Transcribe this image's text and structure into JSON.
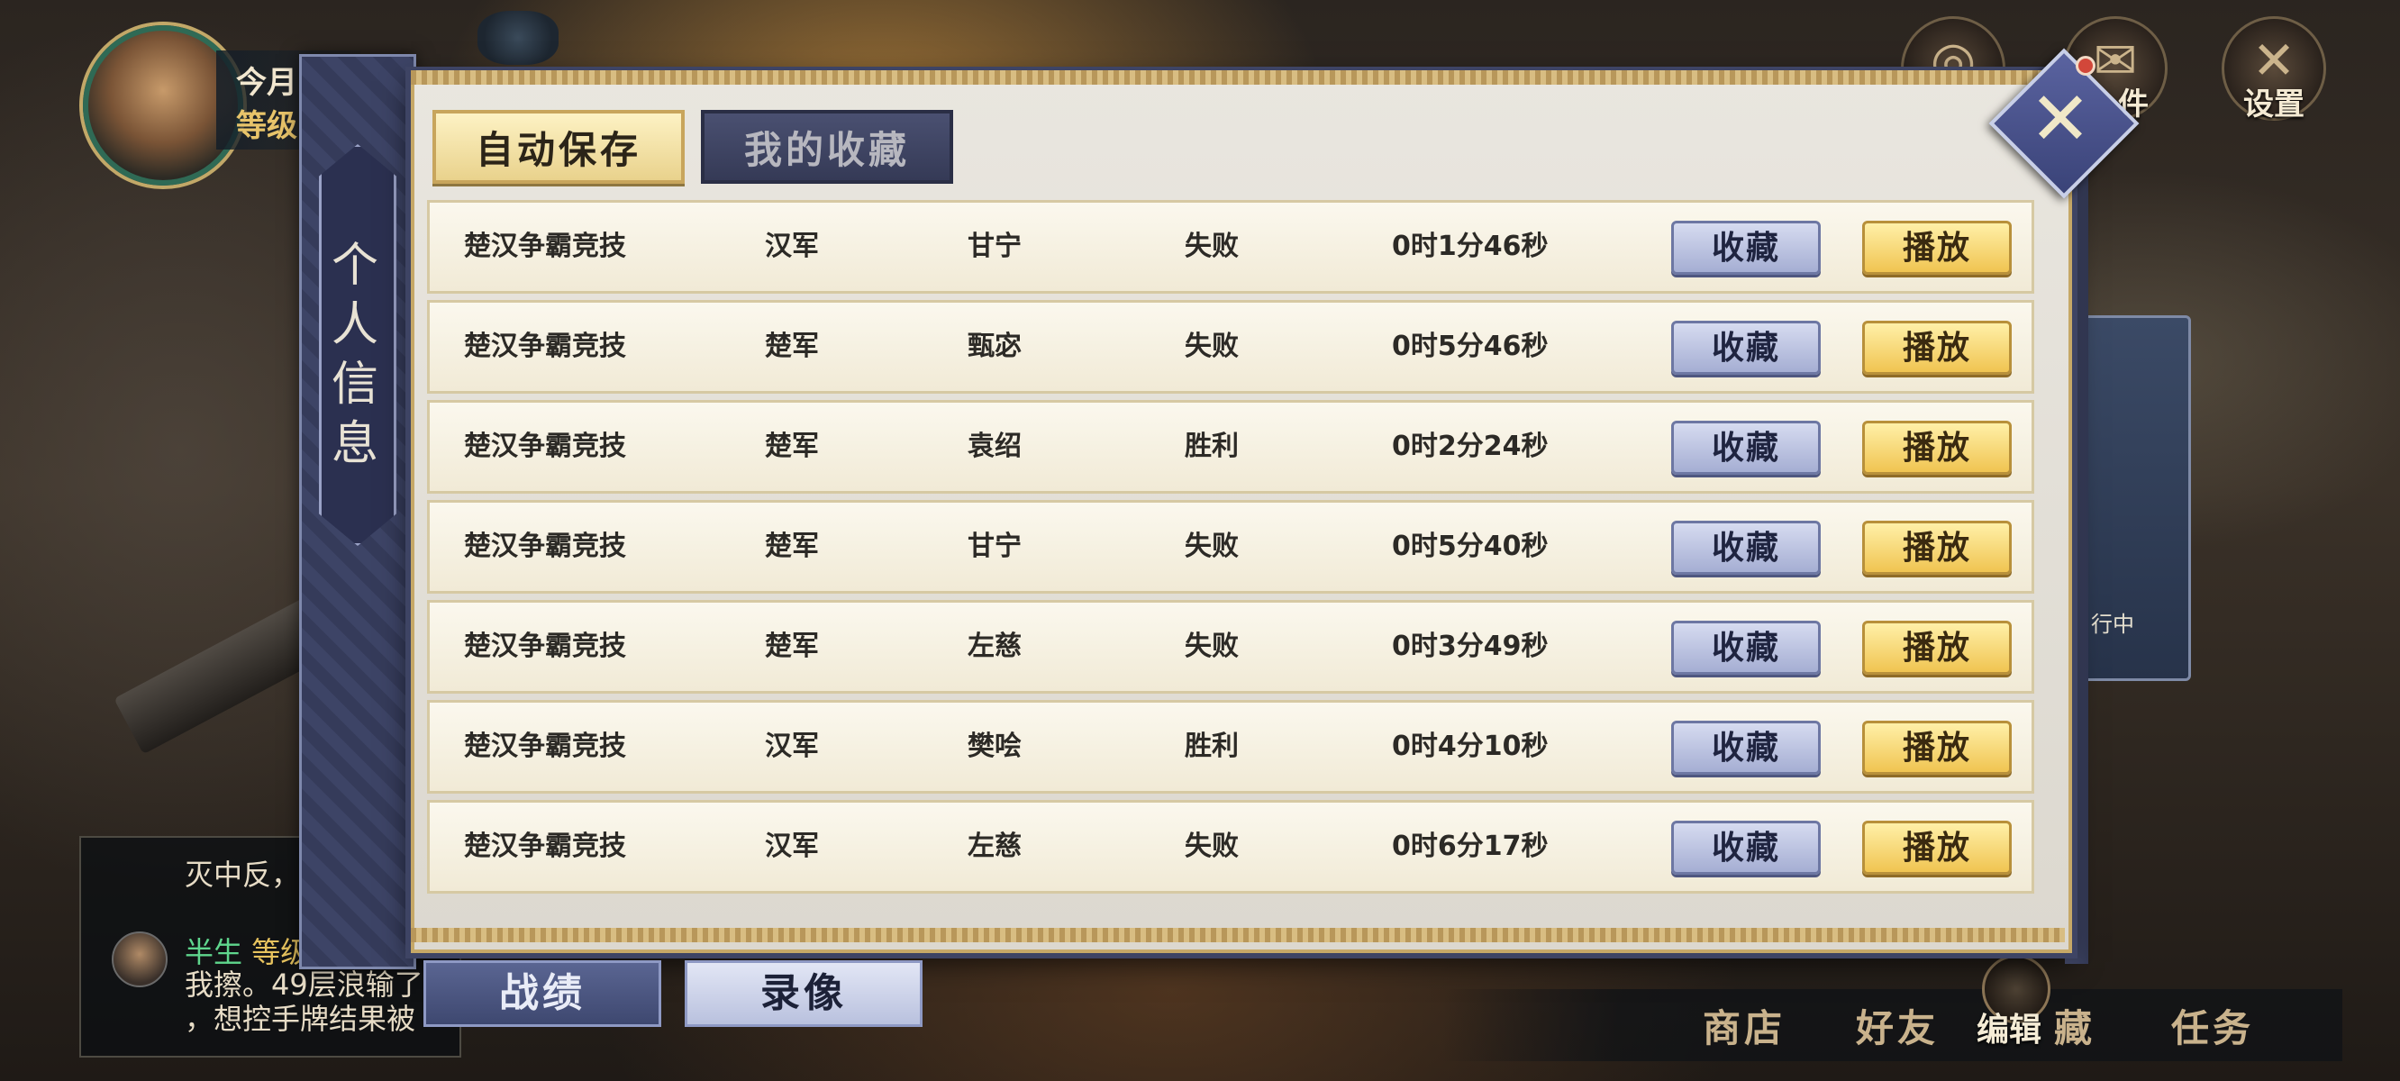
{
  "player": {
    "line1": "今月",
    "line2": "等级"
  },
  "top_icons": [
    {
      "icon": "lantern-icon",
      "label": ""
    },
    {
      "icon": "mail-icon",
      "label": "件"
    },
    {
      "icon": "settings-icon",
      "label": "设置"
    }
  ],
  "side_card_text": "行中",
  "panel_title": "个人信息",
  "tabs": {
    "auto_save": "自动保存",
    "my_favorites": "我的收藏"
  },
  "replays": [
    {
      "mode": "楚汉争霸竞技",
      "side": "汉军",
      "hero": "甘宁",
      "result": "失败",
      "duration": "0时1分46秒",
      "fav": "收藏",
      "play": "播放"
    },
    {
      "mode": "楚汉争霸竞技",
      "side": "楚军",
      "hero": "甄宓",
      "result": "失败",
      "duration": "0时5分46秒",
      "fav": "收藏",
      "play": "播放"
    },
    {
      "mode": "楚汉争霸竞技",
      "side": "楚军",
      "hero": "袁绍",
      "result": "胜利",
      "duration": "0时2分24秒",
      "fav": "收藏",
      "play": "播放"
    },
    {
      "mode": "楚汉争霸竞技",
      "side": "楚军",
      "hero": "甘宁",
      "result": "失败",
      "duration": "0时5分40秒",
      "fav": "收藏",
      "play": "播放"
    },
    {
      "mode": "楚汉争霸竞技",
      "side": "楚军",
      "hero": "左慈",
      "result": "失败",
      "duration": "0时3分49秒",
      "fav": "收藏",
      "play": "播放"
    },
    {
      "mode": "楚汉争霸竞技",
      "side": "汉军",
      "hero": "樊哙",
      "result": "胜利",
      "duration": "0时4分10秒",
      "fav": "收藏",
      "play": "播放"
    },
    {
      "mode": "楚汉争霸竞技",
      "side": "汉军",
      "hero": "左慈",
      "result": "失败",
      "duration": "0时6分17秒",
      "fav": "收藏",
      "play": "播放"
    }
  ],
  "bottom_tabs": {
    "record": "战绩",
    "video": "录像"
  },
  "chat": {
    "line1": "灭中反，",
    "name": "半生",
    "level": "等级",
    "line2": "我擦。49层浪输了",
    "line3": "，想控手牌结果被"
  },
  "nav": {
    "shop": "商店",
    "friends": "好友",
    "collection": "藏",
    "edit": "编辑",
    "tasks": "任务"
  }
}
